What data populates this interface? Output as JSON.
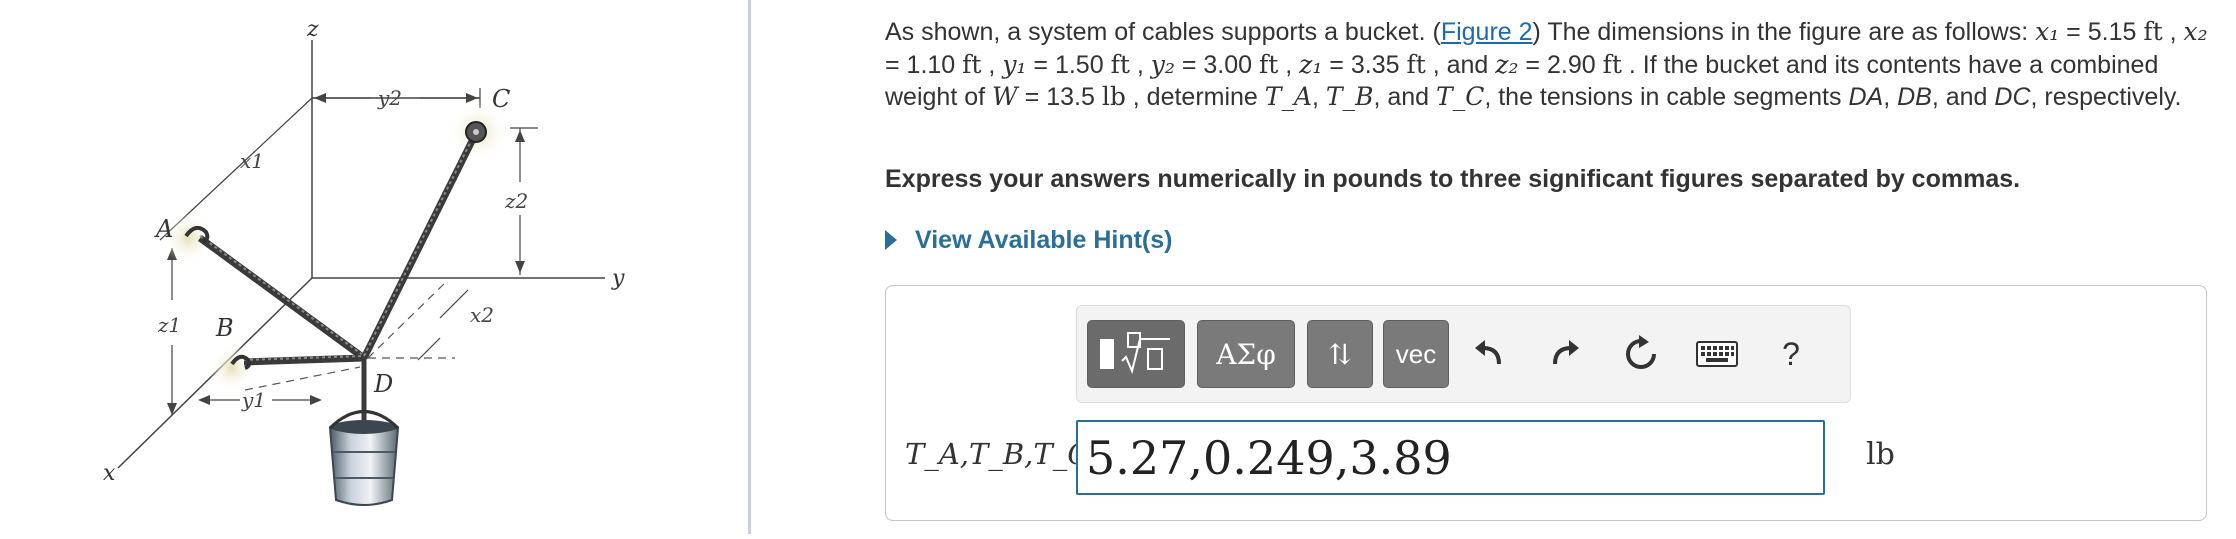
{
  "figure": {
    "labels": {
      "z": "z",
      "y": "y",
      "x": "x",
      "y2": "y2",
      "y1": "y1",
      "x1": "x1",
      "x2": "x2",
      "z1": "z1",
      "z2": "z2",
      "A": "A",
      "B": "B",
      "C": "C",
      "D": "D"
    }
  },
  "problem": {
    "p1": "As shown, a system of cables supports a bucket. (",
    "figure_link": "Figure 2",
    "p2": ") The dimensions in the figure are as follows: ",
    "x1": "x₁",
    "x1_val": " = 5.15 ",
    "x1_unit": "ft",
    "x2_sep": " , ",
    "x2": "x₂",
    "x2_val": " = 1.10 ",
    "x2_unit": "ft",
    "y1_sep": " , ",
    "y1": "y₁",
    "y1_val": " = 1.50 ",
    "y1_unit": "ft",
    "y2_sep": " , ",
    "y2": "y₂",
    "y2_val": " = 3.00 ",
    "y2_unit": "ft",
    "z1_sep": " , ",
    "z1": "z₁",
    "z1_val": " = 3.35 ",
    "z1_unit": "ft",
    "z2_sep": " , and ",
    "z2": "z₂",
    "z2_val": " = 2.90 ",
    "z2_unit": "ft",
    "p3": " . If the bucket and its contents have a combined weight of ",
    "W": "W",
    "W_val": " = 13.5 ",
    "W_unit": "lb",
    "p4": " , determine ",
    "TA": "T_A",
    "sep1": ", ",
    "TB": "T_B",
    "sep2": ", and ",
    "TC": "T_C",
    "p5": ", the tensions in cable segments ",
    "DA": "DA",
    "sep3": ", ",
    "DB": "DB",
    "sep4": ", and ",
    "DC": "DC",
    "p6": ", respectively."
  },
  "instruction": "Express your answers numerically in pounds to three significant figures separated by commas.",
  "hint": {
    "label": "View Available Hint(s)"
  },
  "toolbar": {
    "templates_icon": "fraction-sqrt-template-icon",
    "greek_label": "ΑΣφ",
    "arrows_label": "⇅",
    "vec_label": "vec",
    "undo_icon": "undo-icon",
    "redo_icon": "redo-icon",
    "reset_icon": "reset-icon",
    "keyboard_icon": "keyboard-icon",
    "help_label": "?"
  },
  "answer": {
    "label_var": "T_A,T_B,T_C",
    "label_eq": " =",
    "value": "5.27,0.249,3.89",
    "unit": "lb"
  },
  "colors": {
    "link": "#1a6bb0",
    "hint": "#2a6f97",
    "input_border": "#2a6f97",
    "toolbar_button": "#7a7a7a"
  }
}
